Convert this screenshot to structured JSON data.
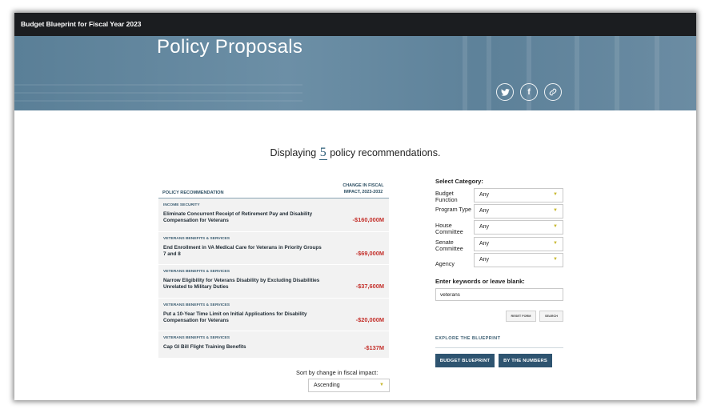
{
  "site_title": "Budget Blueprint for Fiscal Year 2023",
  "page_title": "Policy Proposals",
  "share": {
    "twitter": "twitter-icon",
    "facebook": "facebook-icon",
    "link": "link-icon"
  },
  "results": {
    "prefix": "Displaying",
    "count": "5",
    "suffix": "policy recommendations."
  },
  "table": {
    "col_recommendation": "POLICY RECOMMENDATION",
    "col_impact": "CHANGE IN FISCAL IMPACT, 2023-2032",
    "rows": [
      {
        "category": "INCOME SECURITY",
        "title": "Eliminate Concurrent Receipt of Retirement Pay and Disability Compensation for Veterans",
        "impact": "-$160,000M"
      },
      {
        "category": "VETERANS BENEFITS & SERVICES",
        "title": "End Enrollment in VA Medical Care for Veterans in Priority Groups 7 and 8",
        "impact": "-$69,000M"
      },
      {
        "category": "VETERANS BENEFITS & SERVICES",
        "title": "Narrow Eligibility for Veterans Disability by Excluding Disabilities Unrelated to Military Duties",
        "impact": "-$37,600M"
      },
      {
        "category": "VETERANS BENEFITS & SERVICES",
        "title": "Put a 10-Year Time Limit on Initial Applications for Disability Compensation for Veterans",
        "impact": "-$20,000M"
      },
      {
        "category": "VETERANS BENEFITS & SERVICES",
        "title": "Cap GI Bill Flight Training Benefits",
        "impact": "-$137M"
      }
    ]
  },
  "sort": {
    "label": "Sort by change in fiscal impact:",
    "value": "Ascending"
  },
  "filters": {
    "title": "Select Category:",
    "budget_function": {
      "label": "Budget Function",
      "value": "Any"
    },
    "program_type": {
      "label": "Program Type",
      "value": "Any"
    },
    "house_committee": {
      "label": "House Committee",
      "value": "Any"
    },
    "senate_committee": {
      "label": "Senate Committee",
      "value": "Any"
    },
    "agency": {
      "label": "Agency",
      "value": "Any"
    }
  },
  "keywords": {
    "label": "Enter keywords or leave blank:",
    "value": "veterans"
  },
  "buttons": {
    "reset": "RESET FORM",
    "search": "SEARCH",
    "blueprint": "BUDGET BLUEPRINT",
    "numbers": "BY THE NUMBERS"
  },
  "explore_title": "EXPLORE THE BLUEPRINT"
}
